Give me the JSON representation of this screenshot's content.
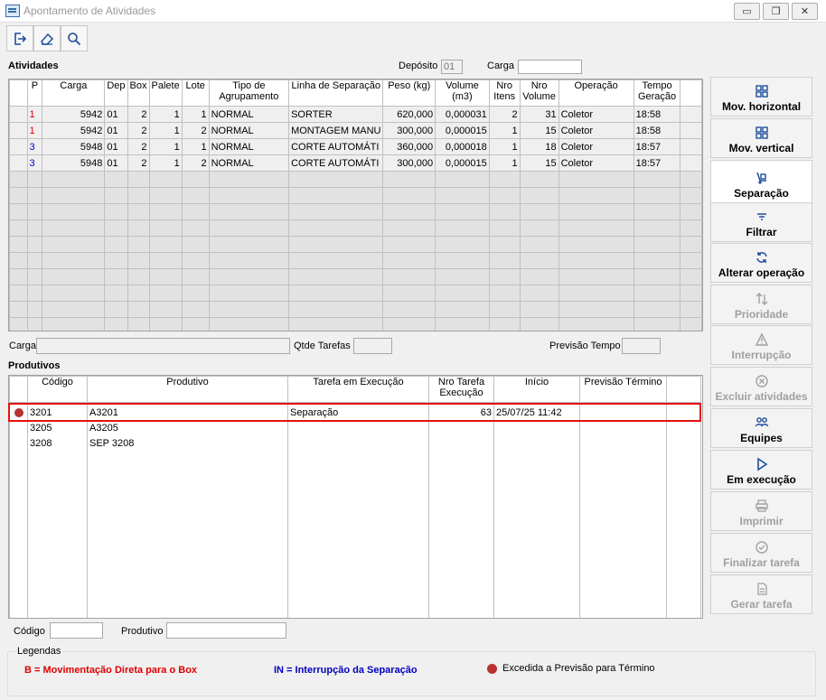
{
  "window": {
    "title": "Apontamento de Atividades",
    "minimize": "▭",
    "restore": "❐",
    "close": "✕"
  },
  "toolbar": {
    "exit_icon": "exit-icon",
    "clear_icon": "eraser-icon",
    "search_icon": "search-icon"
  },
  "activities": {
    "section_title": "Atividades",
    "deposito_label": "Depósito",
    "deposito_value": "01",
    "carga_label": "Carga",
    "carga_value": "",
    "columns": [
      "P",
      "Carga",
      "Dep",
      "Box",
      "Palete",
      "Lote",
      "Tipo de Agrupamento",
      "Linha de Separação",
      "Peso (kg)",
      "Volume (m3)",
      "Nro Itens",
      "Nro Volume",
      "Operação",
      "Tempo Geração"
    ],
    "rows": [
      [
        "1",
        "5942",
        "01",
        "2",
        "1",
        "1",
        "NORMAL",
        "SORTER",
        "620,000",
        "0,000031",
        "2",
        "31",
        "Coletor",
        "18:58"
      ],
      [
        "1",
        "5942",
        "01",
        "2",
        "1",
        "2",
        "NORMAL",
        "MONTAGEM MANU",
        "300,000",
        "0,000015",
        "1",
        "15",
        "Coletor",
        "18:58"
      ],
      [
        "3",
        "5948",
        "01",
        "2",
        "1",
        "1",
        "NORMAL",
        "CORTE AUTOMÁTI",
        "360,000",
        "0,000018",
        "1",
        "18",
        "Coletor",
        "18:57"
      ],
      [
        "3",
        "5948",
        "01",
        "2",
        "1",
        "2",
        "NORMAL",
        "CORTE AUTOMÁTI",
        "300,000",
        "0,000015",
        "1",
        "15",
        "Coletor",
        "18:57"
      ]
    ],
    "priority_colors": [
      "#e00000",
      "#e00000",
      "#0000c0",
      "#0000c0"
    ]
  },
  "filters_mid": {
    "carga_label": "Carga",
    "carga_value": "",
    "qtde_label": "Qtde Tarefas",
    "qtde_value": "",
    "previsao_label": "Previsão Tempo",
    "previsao_value": ""
  },
  "products": {
    "section_title": "Produtivos",
    "columns": [
      "Código",
      "Produtivo",
      "Tarefa em Execução",
      "Nro Tarefa Execução",
      "Início",
      "Previsão Término"
    ],
    "rows": [
      {
        "code": "3201",
        "name": "A3201",
        "task": "Separação",
        "task_no": "63",
        "start": "25/07/25 11:42",
        "end": "",
        "overdue": true
      },
      {
        "code": "3205",
        "name": "A3205",
        "task": "",
        "task_no": "",
        "start": "",
        "end": "",
        "overdue": false
      },
      {
        "code": "3208",
        "name": "SEP 3208",
        "task": "",
        "task_no": "",
        "start": "",
        "end": "",
        "overdue": false
      }
    ]
  },
  "bottom_filters": {
    "codigo_label": "Código",
    "codigo_value": "",
    "produtivo_label": "Produtivo",
    "produtivo_value": ""
  },
  "side_buttons": [
    {
      "label": "Mov. horizontal",
      "icon": "grid-icon",
      "enabled": true
    },
    {
      "label": "Mov. vertical",
      "icon": "grid-icon",
      "enabled": true
    },
    {
      "label": "Separação",
      "icon": "hand-truck-icon",
      "enabled": true
    },
    {
      "label": "Filtrar",
      "icon": "filter-icon",
      "enabled": true
    },
    {
      "label": "Alterar operação",
      "icon": "refresh-icon",
      "enabled": true
    },
    {
      "label": "Prioridade",
      "icon": "sort-icon",
      "enabled": false
    },
    {
      "label": "Interrupção",
      "icon": "warning-icon",
      "enabled": false
    },
    {
      "label": "Excluir atividades",
      "icon": "remove-icon",
      "enabled": false
    },
    {
      "label": "Equipes",
      "icon": "team-icon",
      "enabled": true
    },
    {
      "label": "Em execução",
      "icon": "play-icon",
      "enabled": true
    },
    {
      "label": "Imprimir",
      "icon": "printer-icon",
      "enabled": false
    },
    {
      "label": "Finalizar tarefa",
      "icon": "check-icon",
      "enabled": false
    },
    {
      "label": "Gerar tarefa",
      "icon": "document-icon",
      "enabled": false
    }
  ],
  "legend": {
    "title": "Legendas",
    "item_b": "B = Movimentação Direta para o Box",
    "item_in": "IN = Interrupção da Separação",
    "item_overdue": "Excedida a Previsão para Término",
    "colors": {
      "b": "#e00000",
      "in": "#0000c0",
      "overdue": "#b83232"
    }
  }
}
